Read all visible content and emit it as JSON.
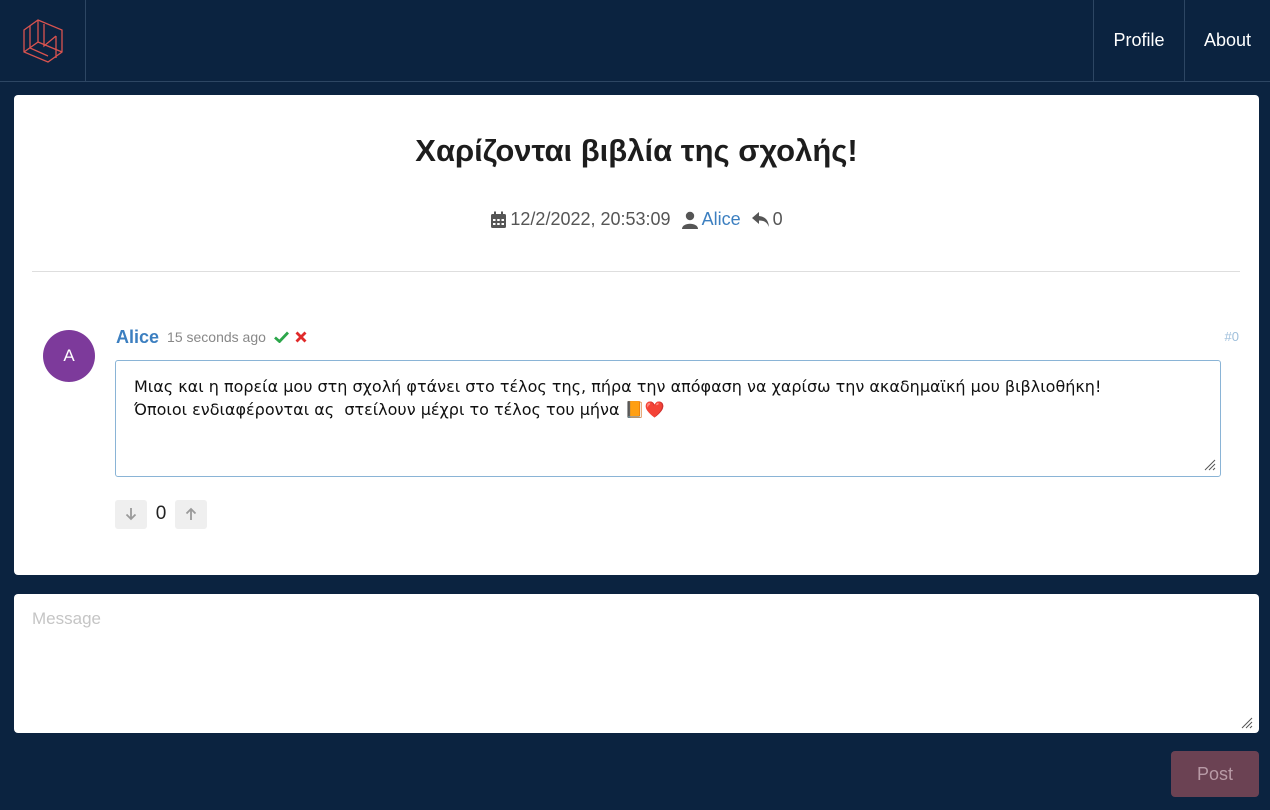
{
  "nav": {
    "profile_label": "Profile",
    "about_label": "About"
  },
  "post": {
    "title": "Χαρίζονται βιβλία της σχολής!",
    "date": "12/2/2022, 20:53:09",
    "author": "Alice",
    "reply_count": "0"
  },
  "comment": {
    "avatar_letter": "A",
    "author": "Alice",
    "time": "15 seconds ago",
    "number": "#0",
    "text": "Μιας και η πορεία μου στη σχολή φτάνει στο τέλος της, πήρα την απόφαση να χαρίσω την ακαδημαϊκή μου βιβλιοθήκη!\nΌποιοι ενδιαφέρονται ας  στείλουν μέχρι το τέλος του μήνα 📙❤️",
    "vote_count": "0"
  },
  "composer": {
    "placeholder": "Message",
    "post_label": "Post"
  },
  "colors": {
    "background": "#0b2340",
    "link": "#3c7fc0",
    "avatar": "#7d3a9b",
    "post_button": "#6b4253"
  },
  "icons": [
    "logo-icon",
    "calendar-icon",
    "user-icon",
    "reply-icon",
    "check-icon",
    "close-icon",
    "arrow-down-icon",
    "arrow-up-icon"
  ]
}
